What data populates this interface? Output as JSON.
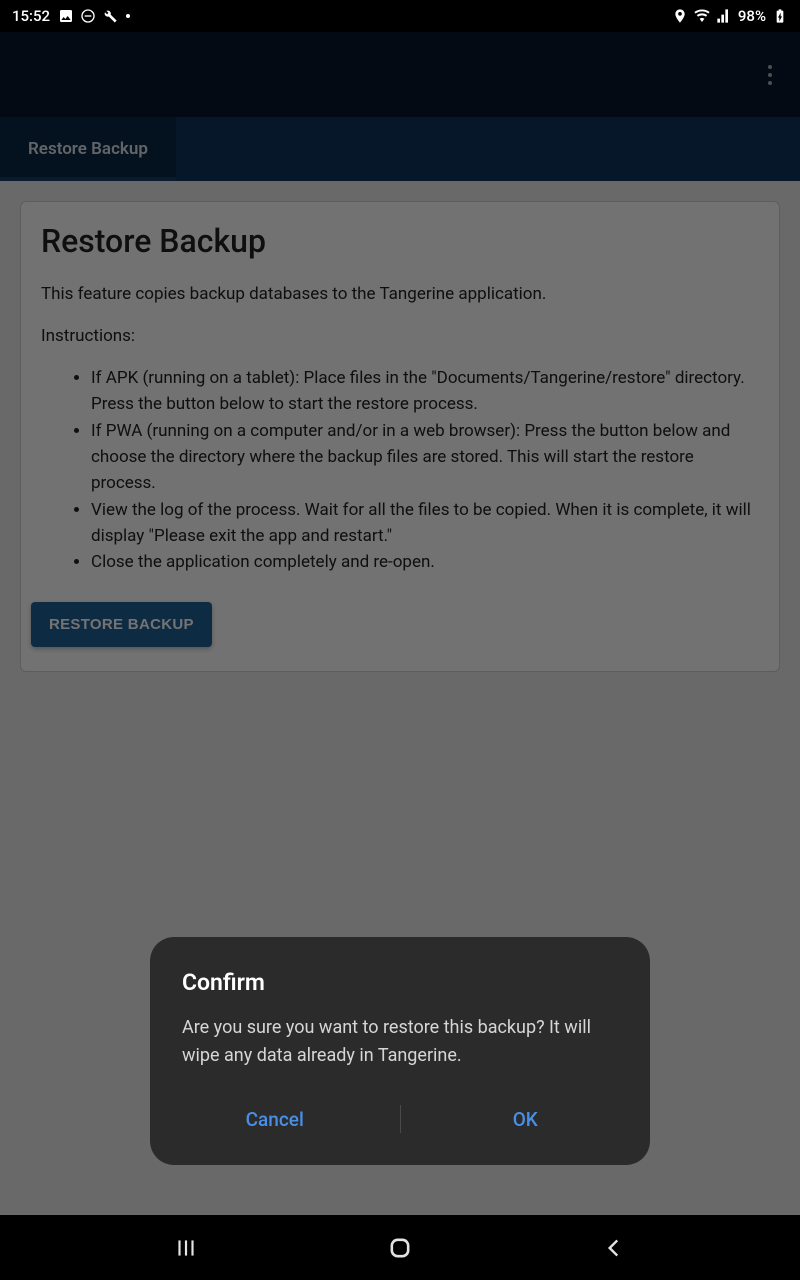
{
  "status": {
    "time": "15:52",
    "battery": "98%"
  },
  "tab": {
    "label": "Restore Backup"
  },
  "page": {
    "heading": "Restore Backup",
    "intro": "This feature copies backup databases to the Tangerine application.",
    "instructions_label": "Instructions:",
    "steps": [
      "If APK (running on a tablet): Place files in the \"Documents/Tangerine/restore\" directory. Press the button below to start the restore process.",
      "If PWA (running on a computer and/or in a web browser): Press the button below and choose the directory where the backup files are stored. This will start the restore process.",
      "View the log of the process. Wait for all the files to be copied. When it is complete, it will display \"Please exit the app and restart.\"",
      "Close the application completely and re-open."
    ],
    "button": "RESTORE BACKUP"
  },
  "dialog": {
    "title": "Confirm",
    "message": "Are you sure you want to restore this backup? It will wipe any data already in Tangerine.",
    "cancel": "Cancel",
    "ok": "OK"
  }
}
